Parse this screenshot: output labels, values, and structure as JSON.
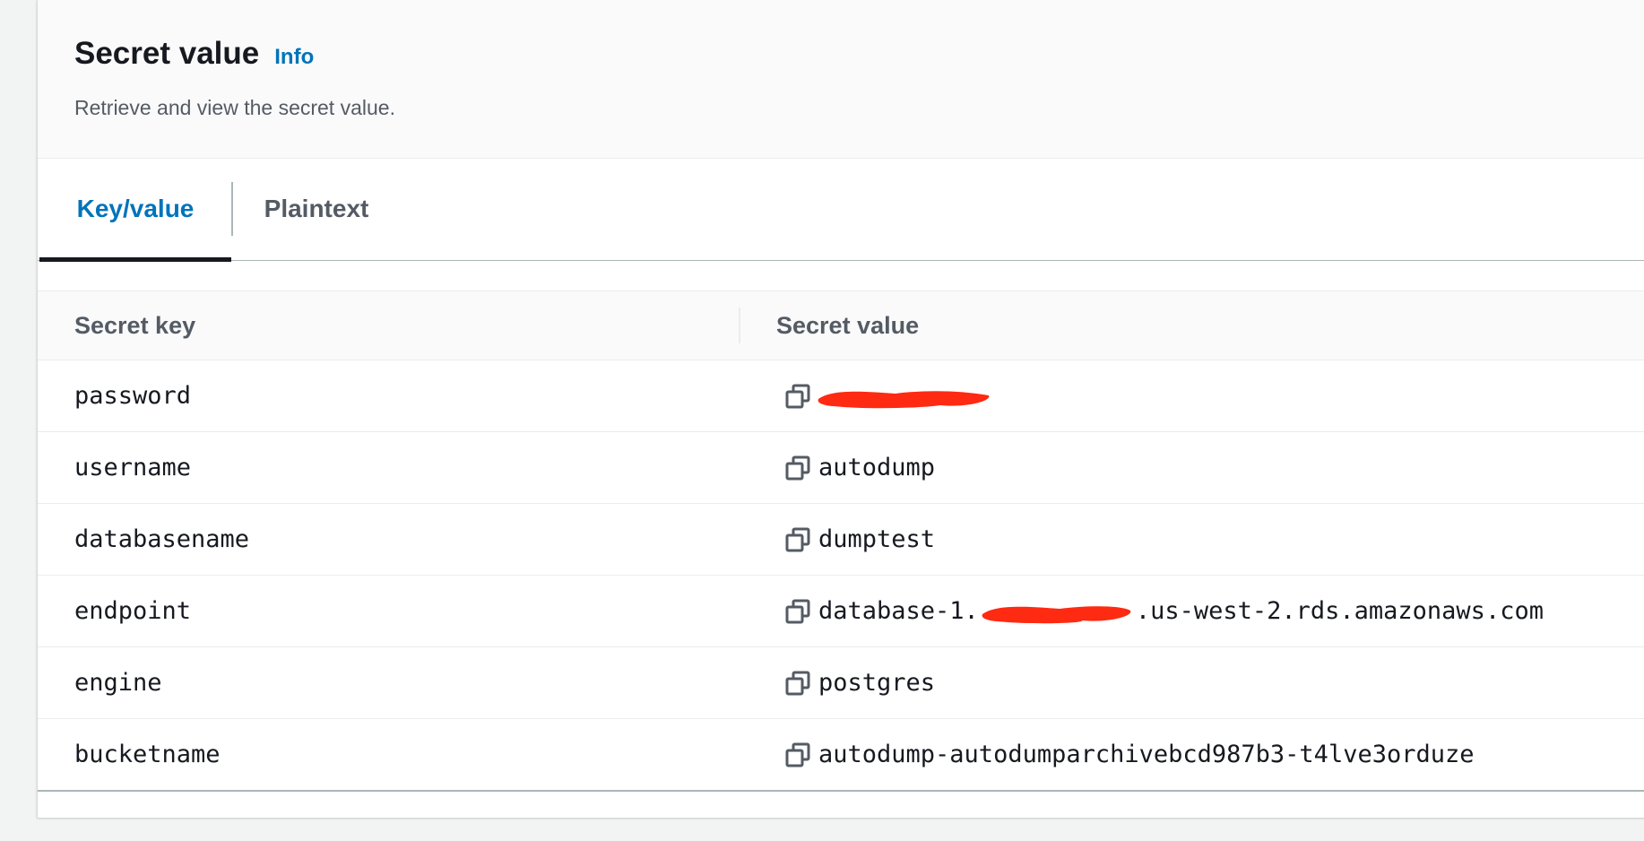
{
  "header": {
    "title": "Secret value",
    "info_link": "Info",
    "description": "Retrieve and view the secret value."
  },
  "tabs": [
    {
      "label": "Key/value",
      "active": true
    },
    {
      "label": "Plaintext",
      "active": false
    }
  ],
  "table": {
    "columns": [
      "Secret key",
      "Secret value"
    ],
    "rows": [
      {
        "key": "password",
        "value_before": "",
        "redacted": true,
        "value_after": ""
      },
      {
        "key": "username",
        "value_before": "autodump",
        "redacted": false,
        "value_after": ""
      },
      {
        "key": "databasename",
        "value_before": "dumptest",
        "redacted": false,
        "value_after": ""
      },
      {
        "key": "endpoint",
        "value_before": "database-1.",
        "redacted": true,
        "value_after": ".us-west-2.rds.amazonaws.com"
      },
      {
        "key": "engine",
        "value_before": "postgres",
        "redacted": false,
        "value_after": ""
      },
      {
        "key": "bucketname",
        "value_before": "autodump-autodumparchivebcd987b3-t4lve3orduze",
        "redacted": false,
        "value_after": ""
      }
    ]
  },
  "icons": {
    "copy": "copy-icon"
  },
  "colors": {
    "link": "#0073bb",
    "text": "#16191f",
    "muted": "#545b64",
    "redaction": "#ff2a12"
  }
}
